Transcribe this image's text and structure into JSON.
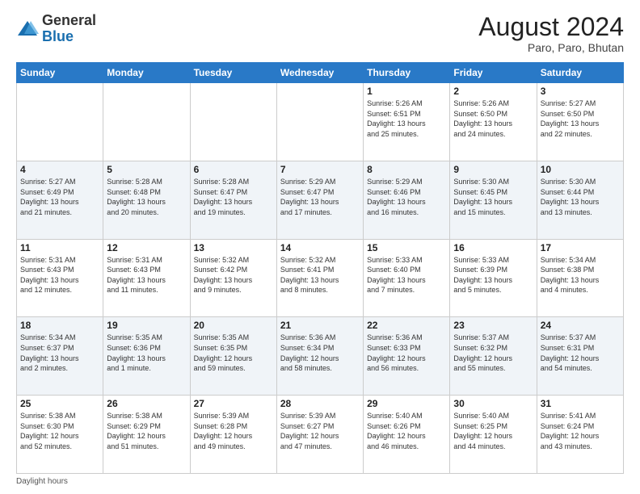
{
  "header": {
    "logo_general": "General",
    "logo_blue": "Blue",
    "month_year": "August 2024",
    "location": "Paro, Paro, Bhutan"
  },
  "days_of_week": [
    "Sunday",
    "Monday",
    "Tuesday",
    "Wednesday",
    "Thursday",
    "Friday",
    "Saturday"
  ],
  "footer": {
    "daylight_label": "Daylight hours"
  },
  "weeks": [
    [
      {
        "day": "",
        "info": ""
      },
      {
        "day": "",
        "info": ""
      },
      {
        "day": "",
        "info": ""
      },
      {
        "day": "",
        "info": ""
      },
      {
        "day": "1",
        "info": "Sunrise: 5:26 AM\nSunset: 6:51 PM\nDaylight: 13 hours\nand 25 minutes."
      },
      {
        "day": "2",
        "info": "Sunrise: 5:26 AM\nSunset: 6:50 PM\nDaylight: 13 hours\nand 24 minutes."
      },
      {
        "day": "3",
        "info": "Sunrise: 5:27 AM\nSunset: 6:50 PM\nDaylight: 13 hours\nand 22 minutes."
      }
    ],
    [
      {
        "day": "4",
        "info": "Sunrise: 5:27 AM\nSunset: 6:49 PM\nDaylight: 13 hours\nand 21 minutes."
      },
      {
        "day": "5",
        "info": "Sunrise: 5:28 AM\nSunset: 6:48 PM\nDaylight: 13 hours\nand 20 minutes."
      },
      {
        "day": "6",
        "info": "Sunrise: 5:28 AM\nSunset: 6:47 PM\nDaylight: 13 hours\nand 19 minutes."
      },
      {
        "day": "7",
        "info": "Sunrise: 5:29 AM\nSunset: 6:47 PM\nDaylight: 13 hours\nand 17 minutes."
      },
      {
        "day": "8",
        "info": "Sunrise: 5:29 AM\nSunset: 6:46 PM\nDaylight: 13 hours\nand 16 minutes."
      },
      {
        "day": "9",
        "info": "Sunrise: 5:30 AM\nSunset: 6:45 PM\nDaylight: 13 hours\nand 15 minutes."
      },
      {
        "day": "10",
        "info": "Sunrise: 5:30 AM\nSunset: 6:44 PM\nDaylight: 13 hours\nand 13 minutes."
      }
    ],
    [
      {
        "day": "11",
        "info": "Sunrise: 5:31 AM\nSunset: 6:43 PM\nDaylight: 13 hours\nand 12 minutes."
      },
      {
        "day": "12",
        "info": "Sunrise: 5:31 AM\nSunset: 6:43 PM\nDaylight: 13 hours\nand 11 minutes."
      },
      {
        "day": "13",
        "info": "Sunrise: 5:32 AM\nSunset: 6:42 PM\nDaylight: 13 hours\nand 9 minutes."
      },
      {
        "day": "14",
        "info": "Sunrise: 5:32 AM\nSunset: 6:41 PM\nDaylight: 13 hours\nand 8 minutes."
      },
      {
        "day": "15",
        "info": "Sunrise: 5:33 AM\nSunset: 6:40 PM\nDaylight: 13 hours\nand 7 minutes."
      },
      {
        "day": "16",
        "info": "Sunrise: 5:33 AM\nSunset: 6:39 PM\nDaylight: 13 hours\nand 5 minutes."
      },
      {
        "day": "17",
        "info": "Sunrise: 5:34 AM\nSunset: 6:38 PM\nDaylight: 13 hours\nand 4 minutes."
      }
    ],
    [
      {
        "day": "18",
        "info": "Sunrise: 5:34 AM\nSunset: 6:37 PM\nDaylight: 13 hours\nand 2 minutes."
      },
      {
        "day": "19",
        "info": "Sunrise: 5:35 AM\nSunset: 6:36 PM\nDaylight: 13 hours\nand 1 minute."
      },
      {
        "day": "20",
        "info": "Sunrise: 5:35 AM\nSunset: 6:35 PM\nDaylight: 12 hours\nand 59 minutes."
      },
      {
        "day": "21",
        "info": "Sunrise: 5:36 AM\nSunset: 6:34 PM\nDaylight: 12 hours\nand 58 minutes."
      },
      {
        "day": "22",
        "info": "Sunrise: 5:36 AM\nSunset: 6:33 PM\nDaylight: 12 hours\nand 56 minutes."
      },
      {
        "day": "23",
        "info": "Sunrise: 5:37 AM\nSunset: 6:32 PM\nDaylight: 12 hours\nand 55 minutes."
      },
      {
        "day": "24",
        "info": "Sunrise: 5:37 AM\nSunset: 6:31 PM\nDaylight: 12 hours\nand 54 minutes."
      }
    ],
    [
      {
        "day": "25",
        "info": "Sunrise: 5:38 AM\nSunset: 6:30 PM\nDaylight: 12 hours\nand 52 minutes."
      },
      {
        "day": "26",
        "info": "Sunrise: 5:38 AM\nSunset: 6:29 PM\nDaylight: 12 hours\nand 51 minutes."
      },
      {
        "day": "27",
        "info": "Sunrise: 5:39 AM\nSunset: 6:28 PM\nDaylight: 12 hours\nand 49 minutes."
      },
      {
        "day": "28",
        "info": "Sunrise: 5:39 AM\nSunset: 6:27 PM\nDaylight: 12 hours\nand 47 minutes."
      },
      {
        "day": "29",
        "info": "Sunrise: 5:40 AM\nSunset: 6:26 PM\nDaylight: 12 hours\nand 46 minutes."
      },
      {
        "day": "30",
        "info": "Sunrise: 5:40 AM\nSunset: 6:25 PM\nDaylight: 12 hours\nand 44 minutes."
      },
      {
        "day": "31",
        "info": "Sunrise: 5:41 AM\nSunset: 6:24 PM\nDaylight: 12 hours\nand 43 minutes."
      }
    ]
  ]
}
